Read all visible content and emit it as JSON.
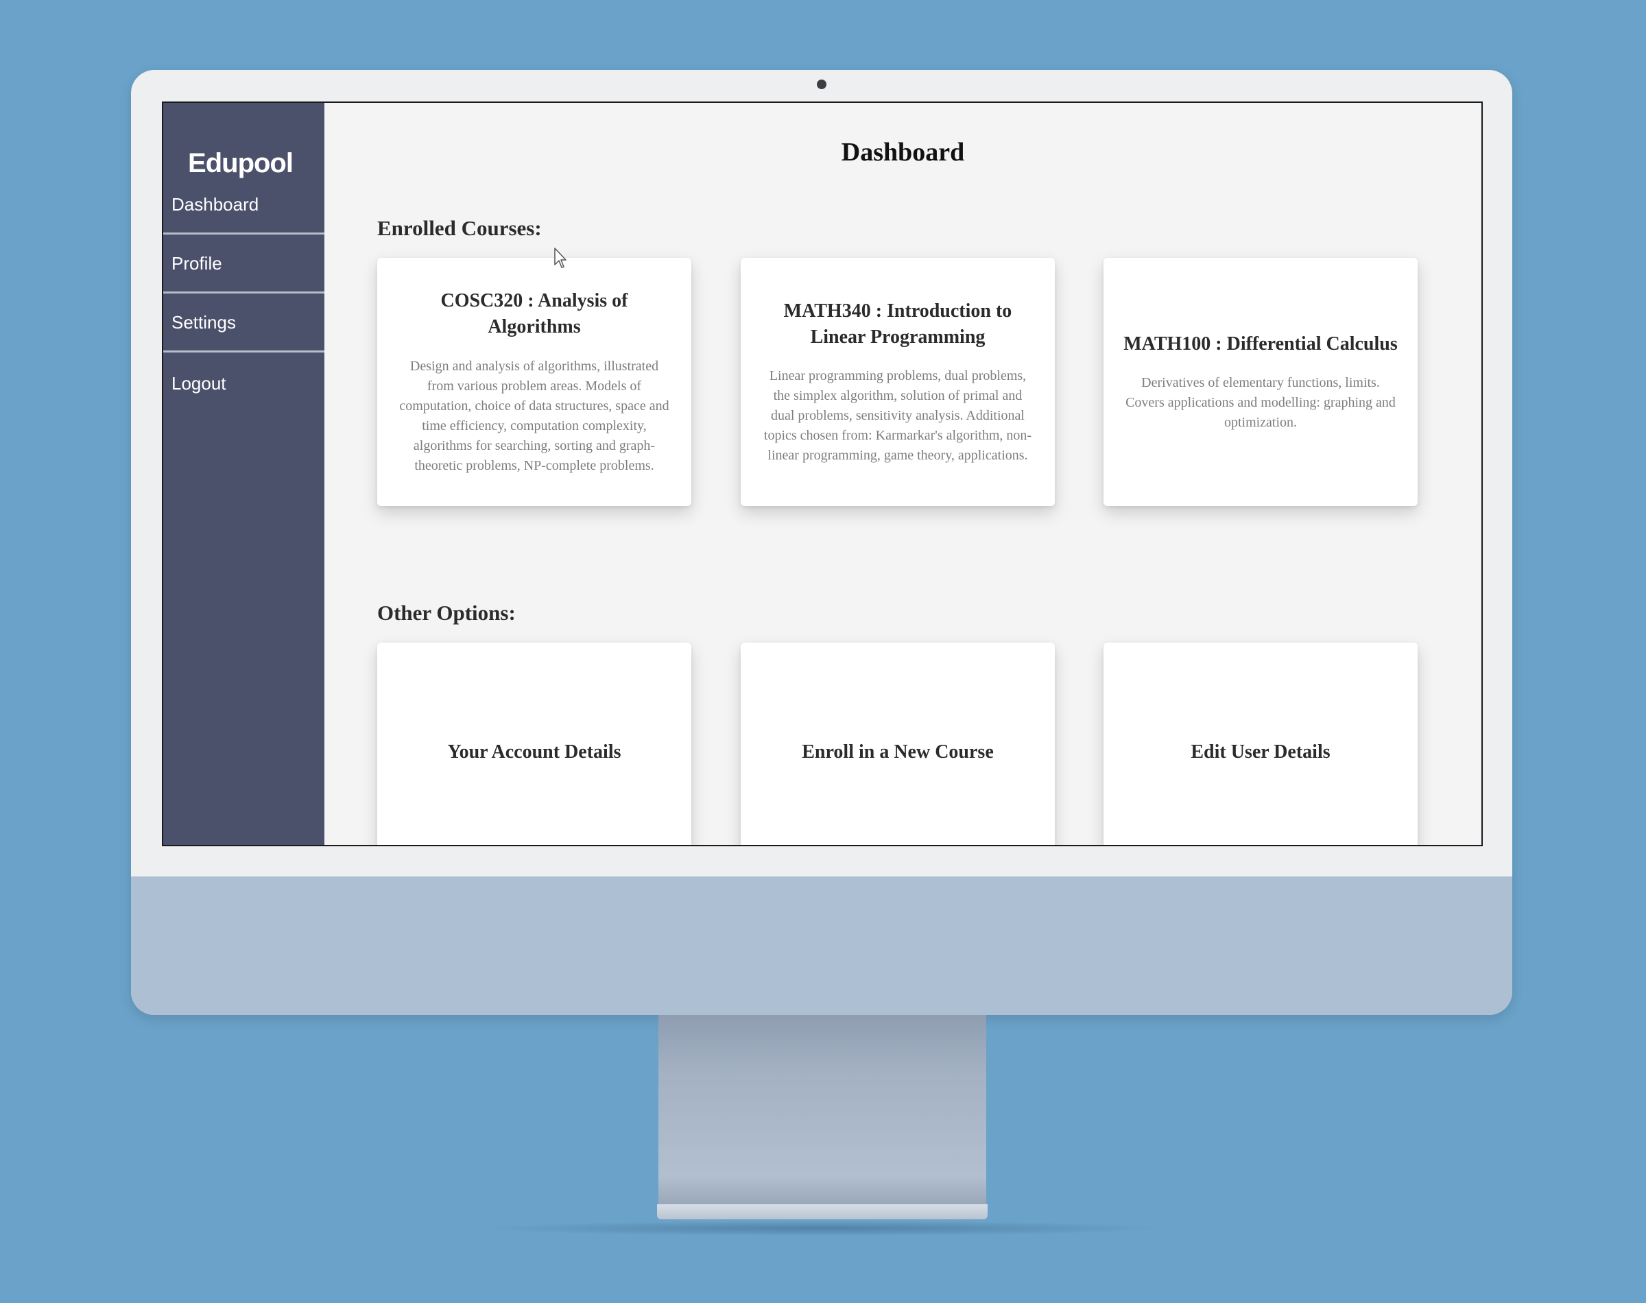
{
  "sidebar": {
    "brand": "Edupool",
    "items": [
      {
        "label": "Dashboard"
      },
      {
        "label": "Profile"
      },
      {
        "label": "Settings"
      },
      {
        "label": "Logout"
      }
    ]
  },
  "main": {
    "title": "Dashboard",
    "enrolled_heading": "Enrolled Courses:",
    "courses": [
      {
        "title": "COSC320 : Analysis of Algorithms",
        "description": "Design and analysis of algorithms, illustrated from various problem areas. Models of computation, choice of data structures, space and time efficiency, computation complexity, algorithms for searching, sorting and graph-theoretic problems, NP-complete problems."
      },
      {
        "title": "MATH340 : Introduction to Linear Programming",
        "description": "Linear programming problems, dual problems, the simplex algorithm, solution of primal and dual problems, sensitivity analysis. Additional topics chosen from: Karmarkar's algorithm, non-linear programming, game theory, applications."
      },
      {
        "title": "MATH100 : Differential Calculus",
        "description": "Derivatives of elementary functions, limits. Covers applications and modelling: graphing and optimization."
      }
    ],
    "options_heading": "Other Options:",
    "options": [
      {
        "label": "Your Account Details"
      },
      {
        "label": "Enroll in a New Course"
      },
      {
        "label": "Edit User Details"
      }
    ]
  },
  "icons": {
    "cursor": "mouse-pointer-icon",
    "camera": "camera-icon"
  },
  "colors": {
    "background": "#6aa2c9",
    "sidebar": "#4b516b",
    "content": "#f4f4f4",
    "card": "#ffffff"
  }
}
